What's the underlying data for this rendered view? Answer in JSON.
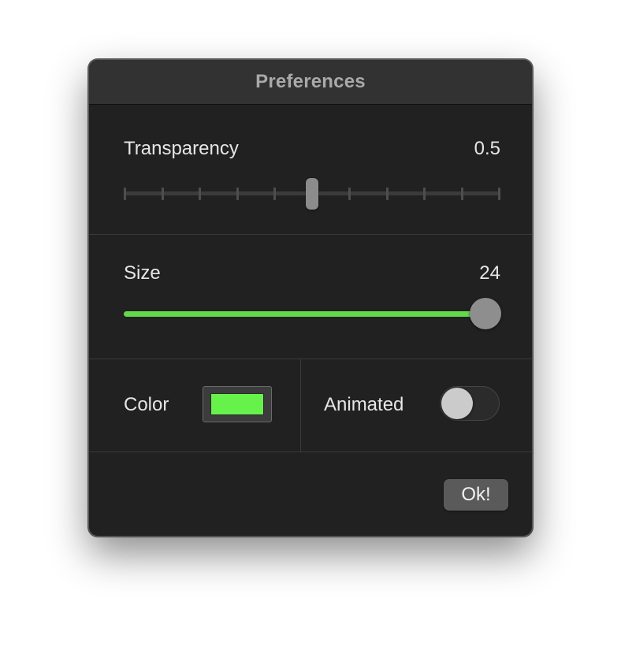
{
  "window": {
    "title": "Preferences"
  },
  "transparency": {
    "label": "Transparency",
    "value_text": "0.5",
    "value": 0.5,
    "min": 0,
    "max": 1,
    "tick_count": 11
  },
  "size": {
    "label": "Size",
    "value_text": "24",
    "value": 24,
    "fill_fraction": 0.96,
    "accent_color": "#63d84a"
  },
  "color": {
    "label": "Color",
    "swatch_color": "#66f14b"
  },
  "animated": {
    "label": "Animated",
    "on": false
  },
  "buttons": {
    "ok_label": "Ok!"
  },
  "icons": {
    "slider_knob": "slider-knob",
    "toggle_switch": "toggle-switch"
  }
}
